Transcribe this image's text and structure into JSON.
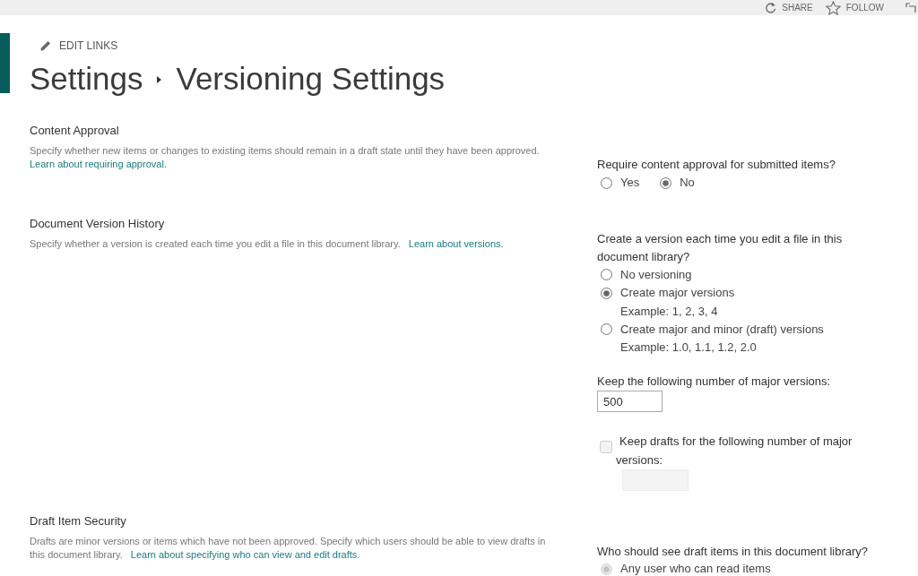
{
  "top_bar": {
    "actions": [
      {
        "kind": "share",
        "label": "SHARE"
      },
      {
        "kind": "follow",
        "label": "FOLLOW"
      },
      {
        "kind": "focus"
      }
    ]
  },
  "edit_links": {
    "label": "EDIT LINKS"
  },
  "breadcrumb": [
    {
      "label": "Settings"
    },
    {
      "label": "Versioning Settings"
    }
  ],
  "sections": [
    {
      "title": "Content Approval",
      "description": "Specify whether new items or changes to existing items should remain in a draft state until they have been approved.",
      "link": "Learn about requiring approval.",
      "controls": [
        {
          "kind": "radio_row",
          "question": "Require content approval for submitted items?",
          "options": [
            {
              "label": "Yes",
              "selected": false,
              "disabled": false
            },
            {
              "label": "No",
              "selected": true,
              "disabled": false
            }
          ]
        }
      ]
    },
    {
      "title": "Document Version History",
      "description": "Specify whether a version is created each time you edit a file in this document library.",
      "link": "Learn about versions.",
      "controls": [
        {
          "kind": "radio_list",
          "question": "Create a version each time you edit a file in this document library?",
          "options": [
            {
              "label": "No versioning",
              "selected": false,
              "disabled": false
            },
            {
              "label": "Create major versions",
              "note": "Example: 1, 2, 3, 4",
              "selected": true,
              "disabled": false
            },
            {
              "label": "Create major and minor (draft) versions",
              "note": "Example: 1.0, 1.1, 1.2, 2.0",
              "selected": false,
              "disabled": false
            }
          ]
        },
        {
          "kind": "number_field",
          "label": "Keep the following number of major versions:",
          "value": "500",
          "disabled": false
        },
        {
          "kind": "checkbox_field",
          "label": "Keep drafts for the following number of major versions:",
          "checked": false,
          "disabled": true
        }
      ]
    },
    {
      "title": "Draft Item Security",
      "description": "Drafts are minor versions or items which have not been approved. Specify which users should be able to view drafts in this document library.",
      "link": "Learn about specifying who can view and edit drafts.",
      "controls": [
        {
          "kind": "radio_list",
          "question": "Who should see draft items in this document library?",
          "options": [
            {
              "label": "Any user who can read items",
              "selected": true,
              "disabled": true
            }
          ]
        }
      ]
    }
  ]
}
